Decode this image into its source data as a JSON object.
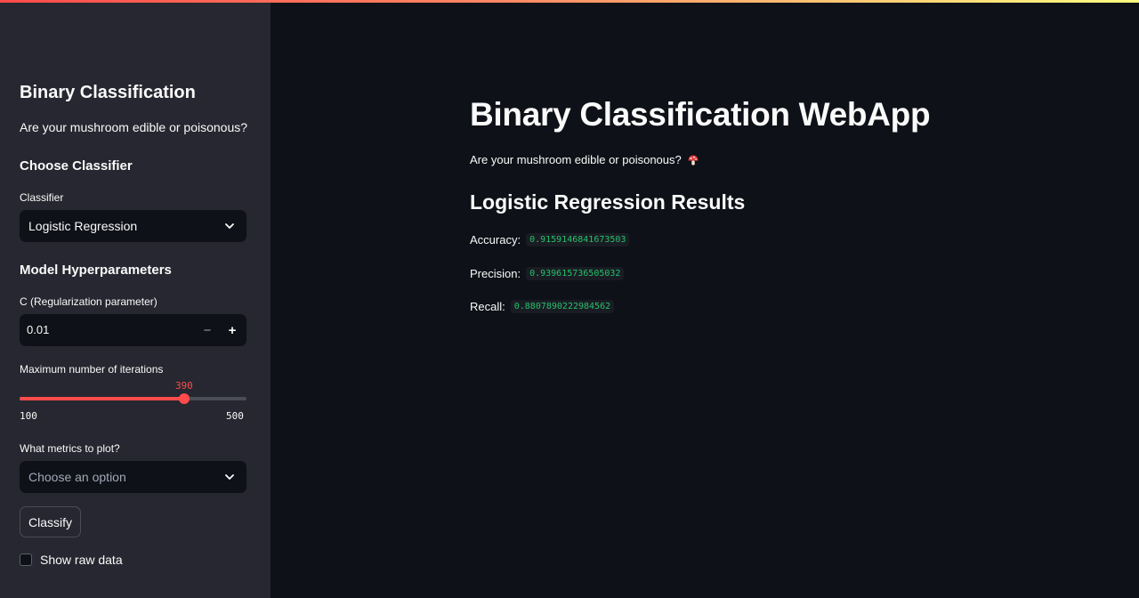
{
  "sidebar": {
    "title": "Binary Classification",
    "caption": "Are your mushroom edible or poisonous?",
    "choose_header": "Choose Classifier",
    "classifier_label": "Classifier",
    "classifier_value": "Logistic Regression",
    "hyper_header": "Model Hyperparameters",
    "c_label": "C (Regularization parameter)",
    "c_value": "0.01",
    "c_minus": "−",
    "c_plus": "+",
    "iter_label": "Maximum number of iterations",
    "iter_value": "390",
    "iter_min": "100",
    "iter_max": "500",
    "iter_fraction": 0.725,
    "metrics_label": "What metrics to plot?",
    "metrics_placeholder": "Choose an option",
    "classify_label": "Classify",
    "raw_data_label": "Show raw data",
    "raw_data_checked": false
  },
  "main": {
    "title": "Binary Classification WebApp",
    "caption": "Are your mushroom edible or poisonous?",
    "caption_icon": "mushroom-icon",
    "results_header": "Logistic Regression Results",
    "metrics": [
      {
        "label": "Accuracy:",
        "value": "0.9159146841673503"
      },
      {
        "label": "Precision:",
        "value": "0.939615736505032"
      },
      {
        "label": "Recall:",
        "value": "0.8807890222984562"
      }
    ]
  },
  "colors": {
    "accent": "#ff4b4b",
    "sidebar_bg": "#262730",
    "main_bg": "#0e1117",
    "code_text": "#23c268"
  }
}
